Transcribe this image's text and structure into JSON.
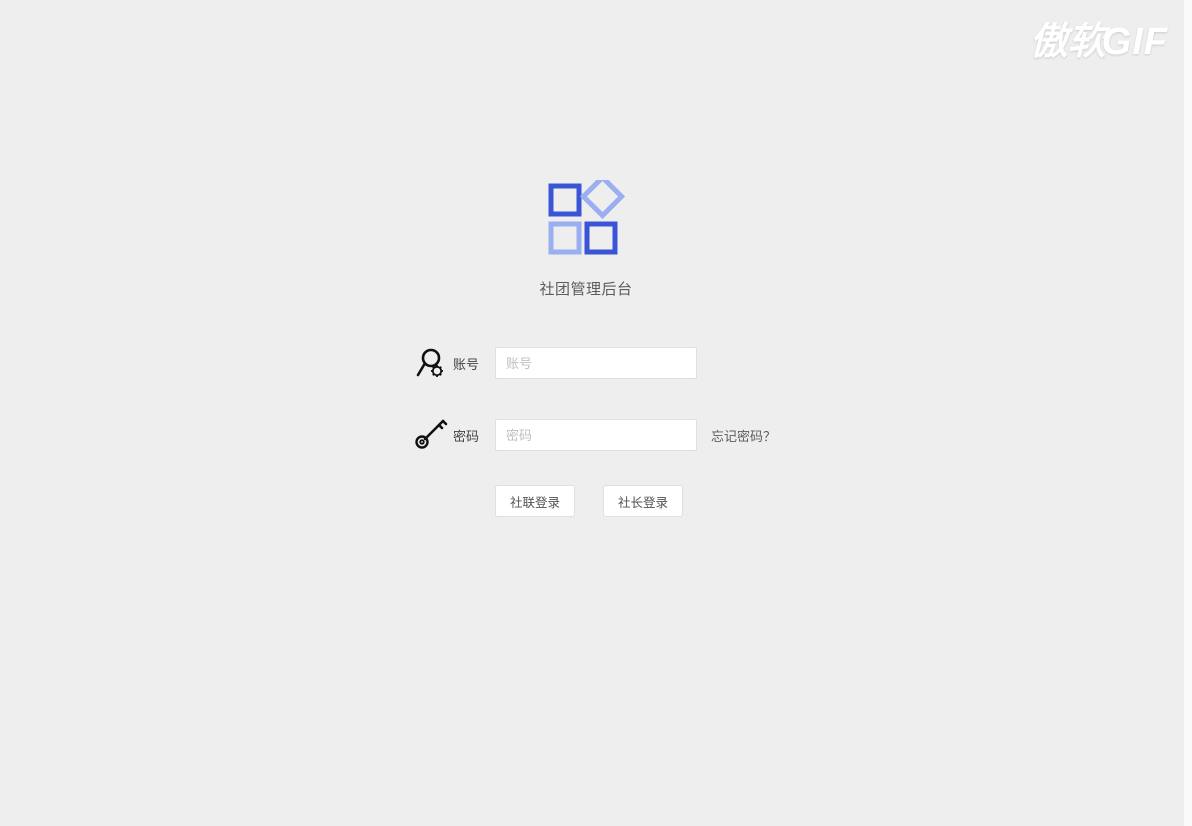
{
  "watermark": {
    "text_cn": "傲软",
    "text_en": "GIF"
  },
  "app": {
    "title": "社团管理后台"
  },
  "form": {
    "account": {
      "label": "账号",
      "placeholder": "账号"
    },
    "password": {
      "label": "密码",
      "placeholder": "密码"
    },
    "forgot": "忘记密码？",
    "buttons": {
      "union_login": "社联登录",
      "president_login": "社长登录"
    }
  },
  "colors": {
    "logo_primary": "#3a54d6",
    "logo_light": "#9aaef0",
    "background": "#eeeeef"
  }
}
